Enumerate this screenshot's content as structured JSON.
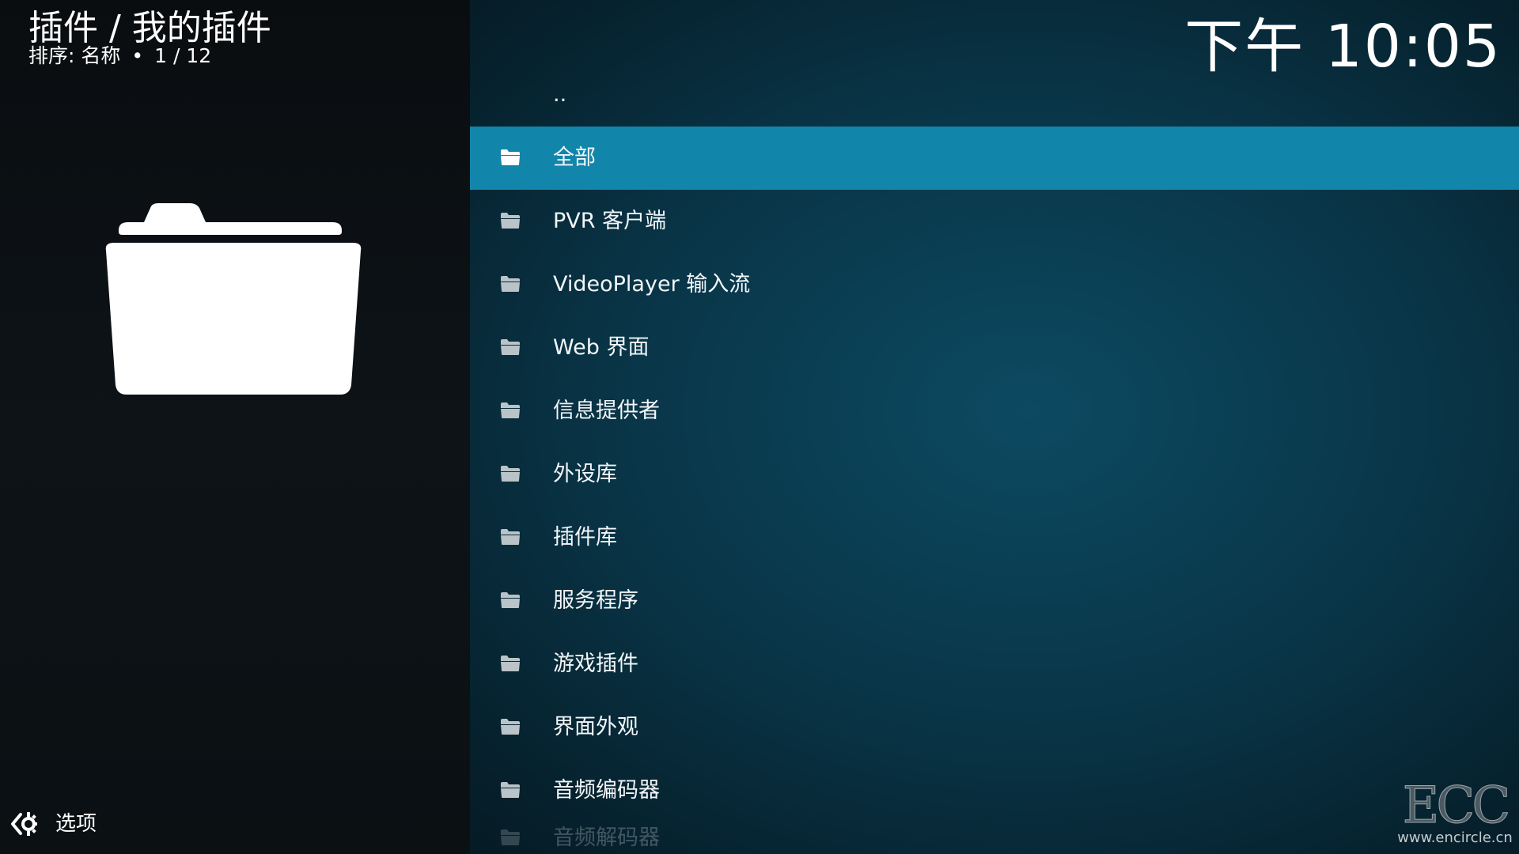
{
  "header": {
    "title": "插件 / 我的插件",
    "sort_label": "排序: 名称",
    "separator": "•",
    "position": "1 / 12"
  },
  "clock": "下午 10:05",
  "options": {
    "label": "选项",
    "icon": "options-gear-icon"
  },
  "list": {
    "items": [
      {
        "label": "..",
        "icon": "none"
      },
      {
        "label": "全部",
        "icon": "folder-icon",
        "selected": true
      },
      {
        "label": "PVR 客户端",
        "icon": "folder-icon"
      },
      {
        "label": "VideoPlayer 输入流",
        "icon": "folder-icon"
      },
      {
        "label": "Web 界面",
        "icon": "folder-icon"
      },
      {
        "label": "信息提供者",
        "icon": "folder-icon"
      },
      {
        "label": "外设库",
        "icon": "folder-icon"
      },
      {
        "label": "插件库",
        "icon": "folder-icon"
      },
      {
        "label": "服务程序",
        "icon": "folder-icon"
      },
      {
        "label": "游戏插件",
        "icon": "folder-icon"
      },
      {
        "label": "界面外观",
        "icon": "folder-icon"
      },
      {
        "label": "音频编码器",
        "icon": "folder-icon"
      },
      {
        "label": "音频解码器",
        "icon": "folder-icon"
      }
    ]
  },
  "watermark": {
    "logo": "ECC",
    "url": "www.encircle.cn"
  },
  "colors": {
    "selected_row": "#1285aa",
    "background": "#093446",
    "left_panel": "#0d1317"
  }
}
